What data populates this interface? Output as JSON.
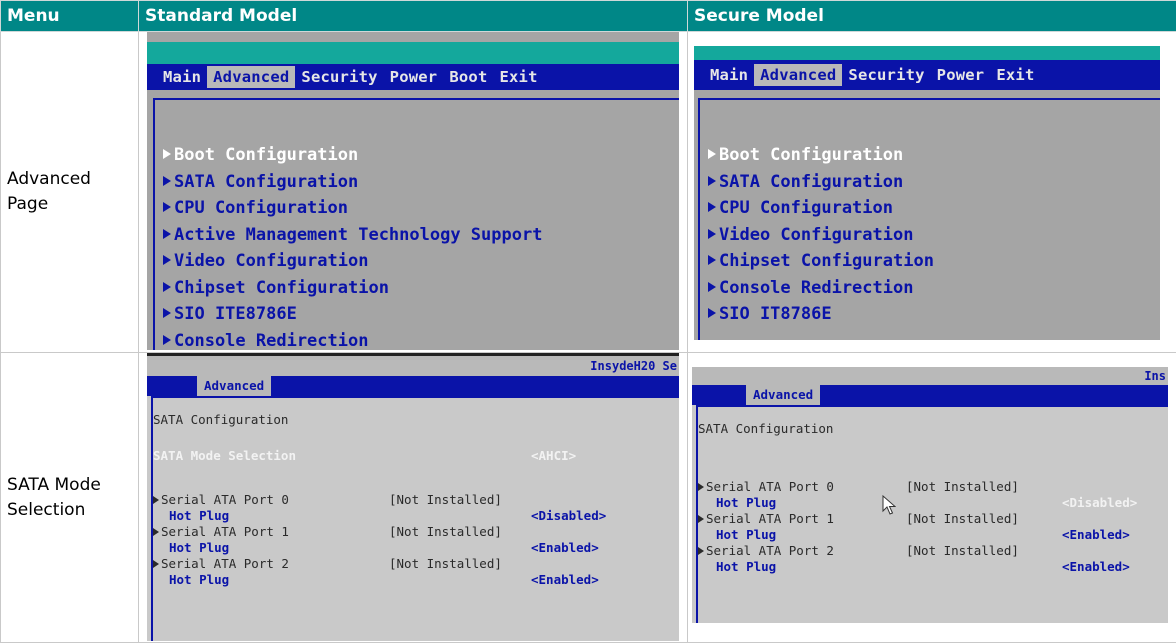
{
  "table": {
    "headers": [
      "Menu",
      "Standard Model",
      "Secure Model"
    ],
    "rows": [
      {
        "menu": "Advanced Page"
      },
      {
        "menu": "SATA Mode Selection"
      }
    ]
  },
  "standard_advanced": {
    "tabs": [
      "Main",
      "Advanced",
      "Security",
      "Power",
      "Boot",
      "Exit"
    ],
    "selected_tab": "Advanced",
    "items": [
      "Boot Configuration",
      "SATA Configuration",
      "CPU Configuration",
      "Active Management Technology Support",
      "Video Configuration",
      "Chipset Configuration",
      "SIO ITE8786E",
      "Console Redirection"
    ]
  },
  "secure_advanced": {
    "tabs": [
      "Main",
      "Advanced",
      "Security",
      "Power",
      "Exit"
    ],
    "selected_tab": "Advanced",
    "items": [
      "Boot Configuration",
      "SATA Configuration",
      "CPU Configuration",
      "Video Configuration",
      "Chipset Configuration",
      "Console Redirection",
      "SIO IT8786E"
    ]
  },
  "standard_sata": {
    "brand": "InsydeH20 Se",
    "tab": "Advanced",
    "section_title": "SATA Configuration",
    "mode_label": "SATA Mode Selection",
    "mode_value": "<AHCI>",
    "ports": [
      {
        "label": "Serial ATA Port 0",
        "status": "[Not Installed]",
        "hotplug_label": "Hot Plug",
        "hotplug_value": "<Disabled>"
      },
      {
        "label": "Serial ATA Port 1",
        "status": "[Not Installed]",
        "hotplug_label": "Hot Plug",
        "hotplug_value": "<Enabled>"
      },
      {
        "label": "Serial ATA Port 2",
        "status": "[Not Installed]",
        "hotplug_label": "Hot Plug",
        "hotplug_value": "<Enabled>"
      }
    ]
  },
  "secure_sata": {
    "brand": "Ins",
    "tab": "Advanced",
    "section_title": "SATA Configuration",
    "ports": [
      {
        "label": "Serial ATA Port 0",
        "status": "[Not Installed]",
        "hotplug_label": "Hot Plug",
        "hotplug_value": "<Disabled>"
      },
      {
        "label": "Serial ATA Port 1",
        "status": "[Not Installed]",
        "hotplug_label": "Hot Plug",
        "hotplug_value": "<Enabled>"
      },
      {
        "label": "Serial ATA Port 2",
        "status": "[Not Installed]",
        "hotplug_label": "Hot Plug",
        "hotplug_value": "<Enabled>"
      }
    ]
  },
  "colors": {
    "header_bg": "#008787",
    "bios_blue": "#0a13a8",
    "bios_gray": "#a5a5a5",
    "bios_teal": "#14a89c"
  },
  "icons": {
    "item_marker": "arrow-right-icon",
    "cursor": "mouse-pointer-icon"
  }
}
